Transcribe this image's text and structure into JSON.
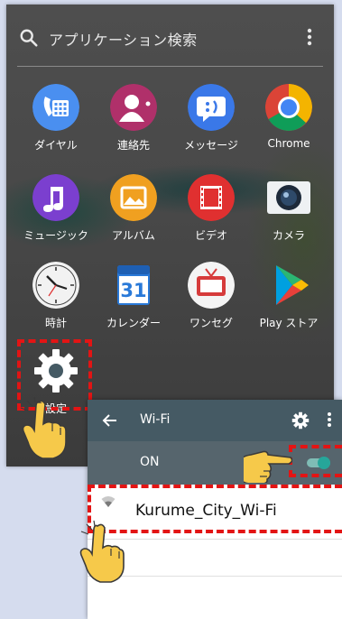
{
  "drawer": {
    "search_placeholder": "アプリケーション検索",
    "apps": [
      {
        "label": "ダイヤル",
        "icon": "phone-icon",
        "color": "#4a8ff0"
      },
      {
        "label": "連絡先",
        "icon": "contacts-icon",
        "color": "#b0306a"
      },
      {
        "label": "メッセージ",
        "icon": "message-icon",
        "color": "#3a78e8"
      },
      {
        "label": "Chrome",
        "icon": "chrome-icon",
        "color": "#ffffff"
      },
      {
        "label": "ミュージック",
        "icon": "music-icon",
        "color": "#7b3fcf"
      },
      {
        "label": "アルバム",
        "icon": "album-icon",
        "color": "#f0a020"
      },
      {
        "label": "ビデオ",
        "icon": "video-icon",
        "color": "#e03030"
      },
      {
        "label": "カメラ",
        "icon": "camera-icon",
        "color": "#eef1f3"
      },
      {
        "label": "時計",
        "icon": "clock-icon",
        "color": "#f2f2f2"
      },
      {
        "label": "カレンダー",
        "icon": "calendar-icon",
        "color": "#2979d8"
      },
      {
        "label": "ワンセグ",
        "icon": "tv-icon",
        "color": "#d63b3b"
      },
      {
        "label": "Play ストア",
        "icon": "play-store-icon",
        "color": "#2bb673"
      },
      {
        "label": "設定",
        "icon": "settings-gear-icon",
        "color": "#455a64"
      }
    ],
    "calendar_day": "31"
  },
  "wifi": {
    "title": "Wi-Fi",
    "switch_label": "ON",
    "network_name": "Kurume_City_Wi-Fi",
    "accent_color": "#26a69a"
  },
  "highlight_color": "#e31414"
}
